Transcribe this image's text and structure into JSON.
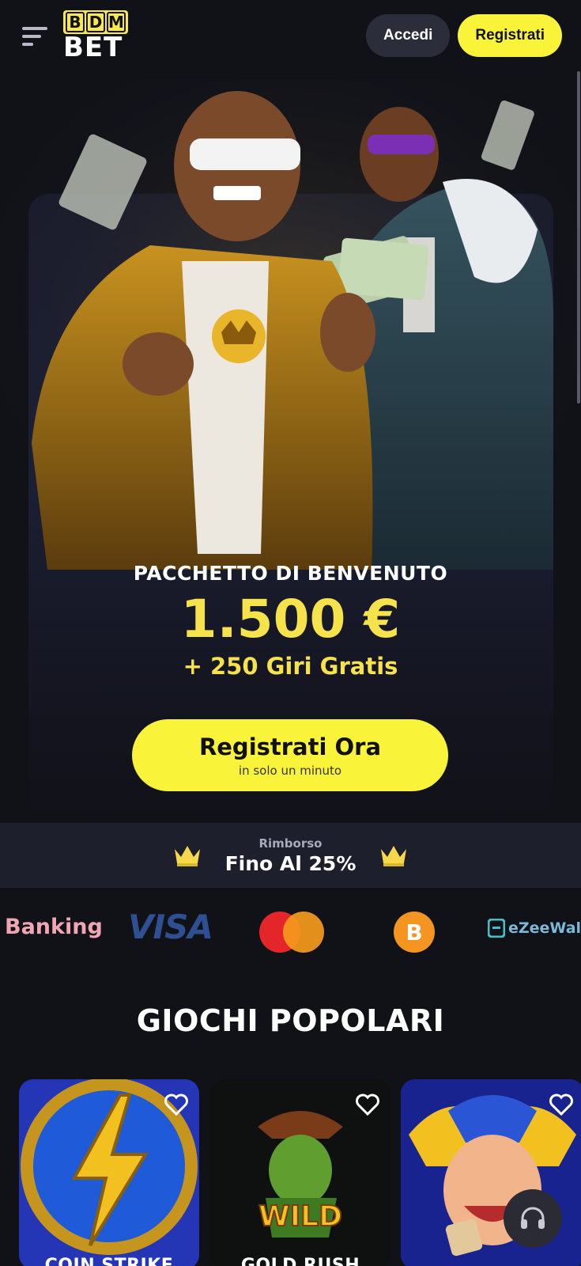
{
  "header": {
    "logo_top": [
      "B",
      "D",
      "M"
    ],
    "logo_bottom": "BET",
    "login_label": "Accedi",
    "register_label": "Registrati"
  },
  "hero": {
    "promo_title": "PACCHETTO DI BENVENUTO",
    "promo_amount": "1.500 €",
    "promo_spins": "+ 250 Giri Gratis",
    "cta_main": "Registrati Ora",
    "cta_sub": "in solo un minuto"
  },
  "cashback": {
    "label": "Rimborso",
    "value": "Fino Al 25%"
  },
  "payments": {
    "banking": "Banking",
    "visa": "VISA",
    "ezee": "eZeeWalle"
  },
  "games_section": {
    "title": "GIOCHI POPOLARI",
    "games": [
      {
        "title": "COIN STRIKE"
      },
      {
        "title": "GOLD RUSH"
      },
      {
        "title": ""
      }
    ]
  },
  "colors": {
    "accent": "#f9f43a",
    "promo_gold": "#f6e24a",
    "background": "#111218"
  }
}
